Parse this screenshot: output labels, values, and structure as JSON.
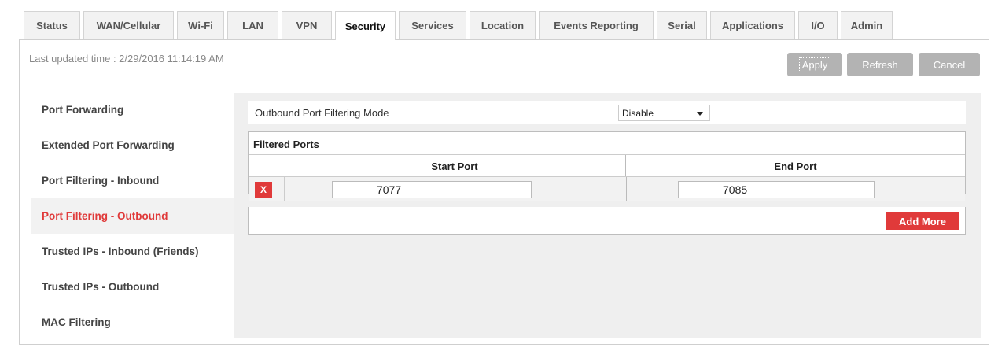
{
  "tabs": [
    {
      "label": "Status"
    },
    {
      "label": "WAN/Cellular"
    },
    {
      "label": "Wi-Fi"
    },
    {
      "label": "LAN"
    },
    {
      "label": "VPN"
    },
    {
      "label": "Security",
      "active": true
    },
    {
      "label": "Services"
    },
    {
      "label": "Location"
    },
    {
      "label": "Events Reporting"
    },
    {
      "label": "Serial"
    },
    {
      "label": "Applications"
    },
    {
      "label": "I/O"
    },
    {
      "label": "Admin"
    }
  ],
  "header": {
    "last_updated": "Last updated time : 2/29/2016 11:14:19 AM",
    "apply_label": "Apply",
    "refresh_label": "Refresh",
    "cancel_label": "Cancel"
  },
  "sidebar": {
    "items": [
      {
        "label": "Port Forwarding"
      },
      {
        "label": "Extended Port Forwarding"
      },
      {
        "label": "Port Filtering - Inbound"
      },
      {
        "label": "Port Filtering - Outbound",
        "active": true
      },
      {
        "label": "Trusted IPs - Inbound (Friends)"
      },
      {
        "label": "Trusted IPs - Outbound"
      },
      {
        "label": "MAC Filtering"
      }
    ]
  },
  "main": {
    "mode_label": "Outbound Port Filtering Mode",
    "mode_value": "Disable",
    "filtered_title": "Filtered Ports",
    "columns": [
      "Start Port",
      "End Port"
    ],
    "rows": [
      {
        "delete_label": "X",
        "start_port": "7077",
        "end_port": "7085"
      }
    ],
    "add_more_label": "Add More"
  },
  "colors": {
    "accent_red": "#e03a3a",
    "button_grey": "#b3b3b3",
    "panel_grey": "#efefef"
  }
}
